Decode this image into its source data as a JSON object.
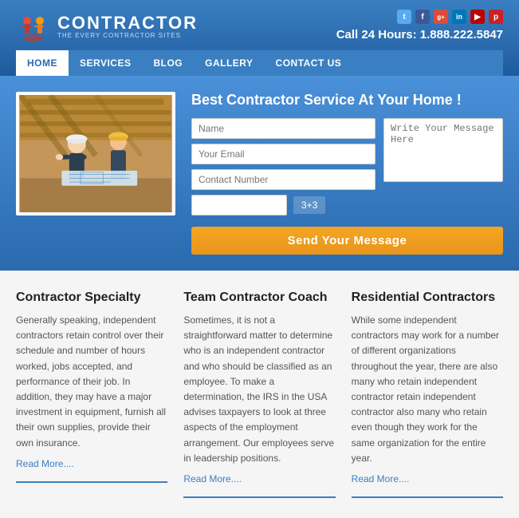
{
  "header": {
    "logo_title": "CONTRACTOR",
    "logo_subtitle": "THE EVERY CONTRACTOR SITES",
    "call_text": "Call 24 Hours: 1.888.222.5847",
    "social": [
      {
        "name": "twitter",
        "label": "t",
        "class": "si-twitter"
      },
      {
        "name": "facebook",
        "label": "f",
        "class": "si-facebook"
      },
      {
        "name": "google",
        "label": "g+",
        "class": "si-google"
      },
      {
        "name": "linkedin",
        "label": "in",
        "class": "si-linkedin"
      },
      {
        "name": "youtube",
        "label": "▶",
        "class": "si-youtube"
      },
      {
        "name": "pinterest",
        "label": "p",
        "class": "si-pinterest"
      }
    ]
  },
  "nav": {
    "items": [
      {
        "label": "HOME",
        "active": true
      },
      {
        "label": "SERVICES",
        "active": false
      },
      {
        "label": "BLOG",
        "active": false
      },
      {
        "label": "GALLERY",
        "active": false
      },
      {
        "label": "CONTACT US",
        "active": false
      }
    ]
  },
  "hero": {
    "title": "Best Contractor Service At Your Home !",
    "form": {
      "name_placeholder": "Name",
      "email_placeholder": "Your Email",
      "phone_placeholder": "Contact Number",
      "captcha_value": "3+3",
      "captcha_placeholder": "",
      "message_placeholder": "Write Your Message Here",
      "send_button": "Send Your Message"
    }
  },
  "features": [
    {
      "title": "Contractor Specialty",
      "text": "Generally speaking, independent contractors retain control over their schedule and number of hours worked, jobs accepted, and performance of their job. In addition, they may have a major investment in equipment, furnish all their own supplies, provide their own insurance.",
      "read_more": "Read More...."
    },
    {
      "title": "Team Contractor Coach",
      "text": "Sometimes, it is not a straightforward matter to determine who is an independent contractor and who should be classified as an employee. To make a determination, the IRS in the USA advises taxpayers to look at three aspects of the employment arrangement. Our employees serve in leadership positions.",
      "read_more": "Read More...."
    },
    {
      "title": "Residential Contractors",
      "text": "While some independent contractors may work for a number of different organizations throughout the year, there are also many who retain independent contractor retain independent contractor also many who retain even though they work for the same organization for the entire year.",
      "read_more": "Read More...."
    }
  ]
}
